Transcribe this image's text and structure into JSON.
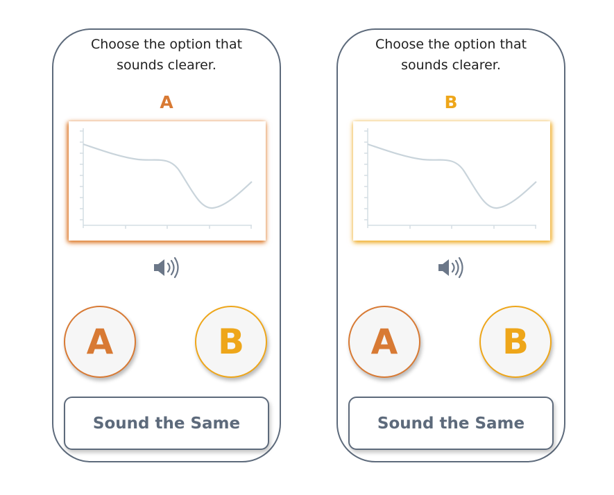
{
  "panels": [
    {
      "prompt_line1": "Choose the option that",
      "prompt_line2": "sounds clearer.",
      "variant_label": "A",
      "variant_color": "#d87a34",
      "chart_glow_color": "#d96f1a",
      "speaker_icon": "speaker-volume-icon",
      "choice_a": "A",
      "choice_b": "B",
      "same_button": "Sound the Same"
    },
    {
      "prompt_line1": "Choose the option that",
      "prompt_line2": "sounds clearer.",
      "variant_label": "B",
      "variant_color": "#eea61a",
      "chart_glow_color": "#eea81c",
      "speaker_icon": "speaker-volume-icon",
      "choice_a": "A",
      "choice_b": "B",
      "same_button": "Sound the Same"
    }
  ],
  "colors": {
    "choice_a": "#d87a34",
    "choice_b": "#eea61a",
    "frame": "#5d6a7b",
    "curve": "#c9d4db"
  }
}
